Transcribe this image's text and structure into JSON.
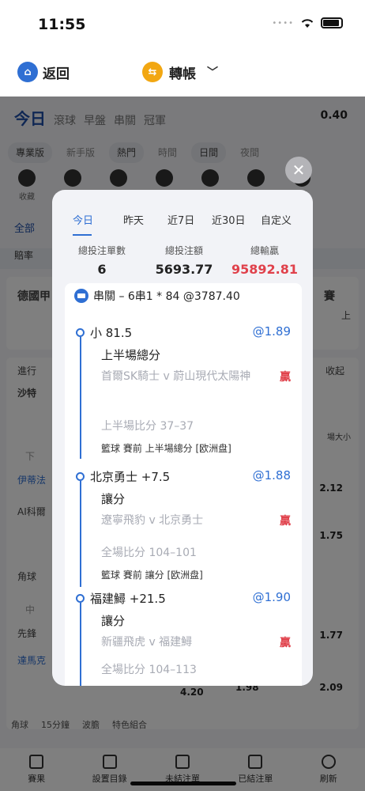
{
  "status_bar": {
    "time": "11:55"
  },
  "nav": {
    "back_label": "返回",
    "transfer_label": "轉帳"
  },
  "background": {
    "tab_today": "今日",
    "tabs": [
      "滾球",
      "早盤",
      "串關",
      "冠軍"
    ],
    "balance": "0.40",
    "filters": [
      "專業版",
      "新手版",
      "熱門",
      "時間",
      "日間",
      "夜間"
    ],
    "sports": [
      "收藏",
      "",
      "",
      "163",
      "129",
      "",
      "16"
    ],
    "all_label": "全部",
    "notice": "賠率",
    "match_title": "德國甲",
    "side_labels": [
      "進行",
      "足球(5",
      "沙特",
      "下",
      "伊蒂法",
      "AI科爾",
      "角球",
      "中",
      "先鋒",
      "達馬克",
      "角球"
    ],
    "right_labels": [
      "賽",
      "上",
      "收起",
      "場大小",
      "3/3.5",
      "2.12",
      "3/3.5",
      "1.75",
      "55+",
      "2/2.5",
      "1.77",
      "2/2.5",
      "2.09",
      "4.20",
      "1.98"
    ],
    "bottom_chips": [
      "角球",
      "15分鐘",
      "波膽",
      "特色組合"
    ],
    "bottom_tabs": [
      "賽果",
      "設置目錄",
      "未結注單",
      "已結注單",
      "刷新"
    ]
  },
  "modal": {
    "date_tabs": [
      "今日",
      "昨天",
      "近7日",
      "近30日",
      "自定义"
    ],
    "stats": [
      {
        "label": "總投注單數",
        "value": "6"
      },
      {
        "label": "總投注額",
        "value": "5693.77"
      },
      {
        "label": "總輸贏",
        "value": "95892.81"
      }
    ],
    "bet_header": "串關 – 6串1 * 84 @3787.40",
    "legs": [
      {
        "title": "小 81.5",
        "odds": "@1.89",
        "market": "上半場總分",
        "match": "首爾SK騎士 v 蔚山現代太陽神",
        "result": "贏",
        "score": "上半場比分 37–37",
        "meta": "籃球 賽前 上半場總分 [欧洲盘]"
      },
      {
        "title": "北京勇士 +7.5",
        "odds": "@1.88",
        "market": "讓分",
        "match": "遼寧飛豹 v 北京勇士",
        "result": "贏",
        "score": "全場比分 104–101",
        "meta": "籃球 賽前 讓分 [欧洲盘]"
      },
      {
        "title": "福建鱘 +21.5",
        "odds": "@1.90",
        "market": "讓分",
        "match": "新疆飛虎 v 福建鱘",
        "result": "贏",
        "score": "全場比分 104–113",
        "meta": ""
      }
    ]
  }
}
